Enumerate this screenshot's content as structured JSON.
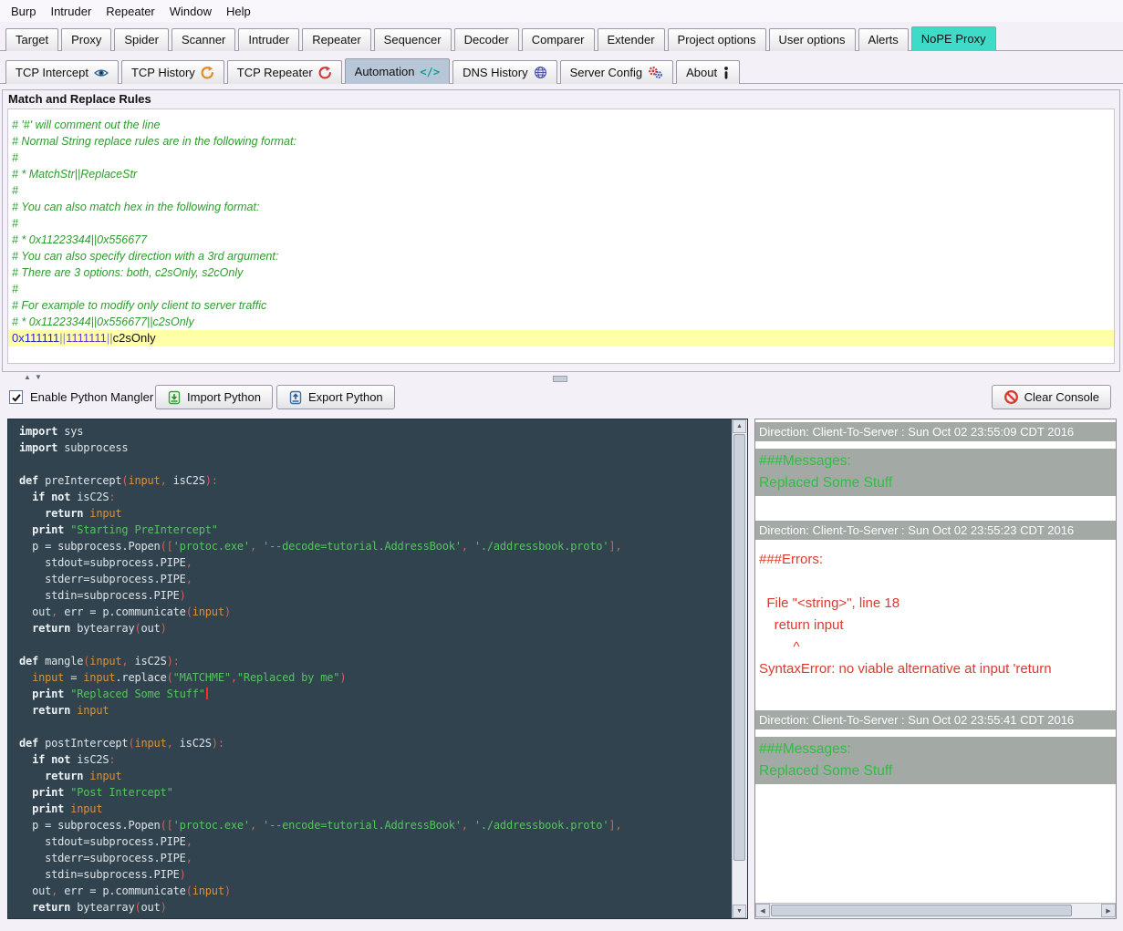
{
  "menubar": {
    "items": [
      "Burp",
      "Intruder",
      "Repeater",
      "Window",
      "Help"
    ]
  },
  "main_tabs": {
    "tabs": [
      {
        "label": "Target"
      },
      {
        "label": "Proxy"
      },
      {
        "label": "Spider"
      },
      {
        "label": "Scanner"
      },
      {
        "label": "Intruder"
      },
      {
        "label": "Repeater"
      },
      {
        "label": "Sequencer"
      },
      {
        "label": "Decoder"
      },
      {
        "label": "Comparer"
      },
      {
        "label": "Extender"
      },
      {
        "label": "Project options"
      },
      {
        "label": "User options"
      },
      {
        "label": "Alerts"
      },
      {
        "label": "NoPE Proxy",
        "selected": true
      }
    ]
  },
  "sub_tabs": {
    "tabs": [
      {
        "label": "TCP Intercept",
        "icon": "eye-icon"
      },
      {
        "label": "TCP History",
        "icon": "recycle-orange-icon"
      },
      {
        "label": "TCP Repeater",
        "icon": "recycle-red-icon"
      },
      {
        "label": "Automation",
        "icon": "code-icon",
        "selected": true
      },
      {
        "label": "DNS History",
        "icon": "globe-icon"
      },
      {
        "label": "Server Config",
        "icon": "gears-icon"
      },
      {
        "label": "About",
        "icon": "info-icon"
      }
    ]
  },
  "match_replace": {
    "title": "Match and Replace Rules",
    "comment_lines": [
      "# '#' will comment out the line",
      "# Normal String replace rules are in the following format:",
      "#",
      "# * MatchStr||ReplaceStr",
      "#",
      "# You can also match hex in the following format:",
      "#",
      "# * 0x11223344||0x556677",
      "# You can also specify direction with a 3rd argument:",
      "# There are 3 options: both, c2sOnly, s2cOnly",
      "#",
      "# For example to modify only client to server traffic",
      "# * 0x11223344||0x556677||c2sOnly"
    ],
    "active_rule": {
      "parts": [
        {
          "text": "0x111111",
          "color": "#2a2ad0"
        },
        {
          "text": "||",
          "color": "#8a8ab0"
        },
        {
          "text": "1111111",
          "color": "#6a3ad0"
        },
        {
          "text": "||",
          "color": "#8a8ab0"
        },
        {
          "text": "c2sOnly",
          "color": "#101010"
        }
      ]
    }
  },
  "mangler_bar": {
    "enable_checkbox": {
      "label": "Enable Python Mangler",
      "checked": true
    },
    "import_button": "Import Python",
    "export_button": "Export Python",
    "clear_console_button": "Clear Console"
  },
  "editor": {
    "cursor_line_index": 16,
    "code_lines": [
      "import sys",
      "import subprocess",
      "",
      "def preIntercept(input, isC2S):",
      "  if not isC2S:",
      "    return input",
      "  print \"Starting PreIntercept\"",
      "  p = subprocess.Popen(['protoc.exe', '--decode=tutorial.AddressBook', './addressbook.proto'],",
      "    stdout=subprocess.PIPE,",
      "    stderr=subprocess.PIPE,",
      "    stdin=subprocess.PIPE)",
      "  out, err = p.communicate(input)",
      "  return bytearray(out)",
      "",
      "def mangle(input, isC2S):",
      "  input = input.replace(\"MATCHME\",\"Replaced by me\")",
      "  print \"Replaced Some Stuff\"",
      "  return input",
      "",
      "def postIntercept(input, isC2S):",
      "  if not isC2S:",
      "    return input",
      "  print \"Post Intercept\"",
      "  print input",
      "  p = subprocess.Popen(['protoc.exe', '--encode=tutorial.AddressBook', './addressbook.proto'],",
      "    stdout=subprocess.PIPE,",
      "    stderr=subprocess.PIPE,",
      "    stdin=subprocess.PIPE)",
      "  out, err = p.communicate(input)",
      "  return bytearray(out)"
    ]
  },
  "console": {
    "entries": [
      {
        "type": "header",
        "text": "Direction: Client-To-Server : Sun Oct 02 23:55:09 CDT 2016"
      },
      {
        "type": "messages",
        "lines": [
          "###Messages:",
          "Replaced Some Stuff"
        ]
      },
      {
        "type": "header",
        "text": "Direction: Client-To-Server : Sun Oct 02 23:55:23 CDT 2016"
      },
      {
        "type": "errors",
        "lines": [
          "###Errors:",
          "",
          "  File \"<string>\", line 18",
          "    return input",
          "         ^",
          "SyntaxError: no viable alternative at input 'return"
        ]
      },
      {
        "type": "header",
        "text": "Direction: Client-To-Server : Sun Oct 02 23:55:41 CDT 2016"
      },
      {
        "type": "messages",
        "lines": [
          "###Messages:",
          "Replaced Some Stuff"
        ]
      }
    ]
  },
  "colors": {
    "page_bg": "#f3f1f7",
    "menu_bg": "#f9f7fc",
    "tab_border": "#9b99a3",
    "accent_teal": "#3edbc8",
    "subtab_selected": "#b7c7d8",
    "editor_bg": "#31434e",
    "band_gray": "#a3aaa6",
    "msg_green": "#2ebf3f",
    "err_red": "#df392c",
    "comment_green": "#2f9b2f",
    "highlight_yellow": "#ffffa8",
    "string_green": "#57c163",
    "keyword_white": "#eef3f7",
    "punct_red": "#d95f57",
    "param_orange": "#d6923c"
  }
}
